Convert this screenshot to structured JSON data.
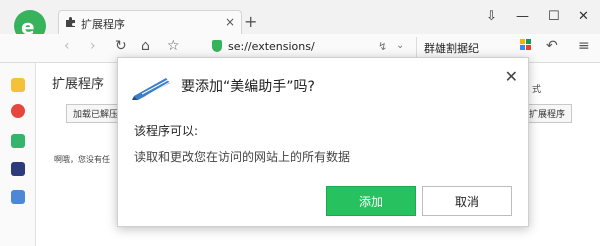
{
  "browser": {
    "tab_label": "扩展程序",
    "tab_close": "×",
    "new_tab": "+",
    "address": "se://extensions/",
    "search_text": "群雄割据纪",
    "window_controls": [
      "⇩",
      "—",
      "☐",
      "✕"
    ]
  },
  "page": {
    "title": "扩展程序",
    "load_button": "加载已解压",
    "right_button": "扩展程序",
    "right_text": "式",
    "note": "啊哦，您没有任"
  },
  "dialog": {
    "title": "要添加“美编助手”吗?",
    "close": "✕",
    "permissions_heading": "该程序可以:",
    "permission_item": "读取和更改您在访问的网站上的所有数据",
    "add_button": "添加",
    "cancel_button": "取消"
  },
  "colors": {
    "add_button": "#27c15f",
    "logo_green": "#37b35b"
  }
}
